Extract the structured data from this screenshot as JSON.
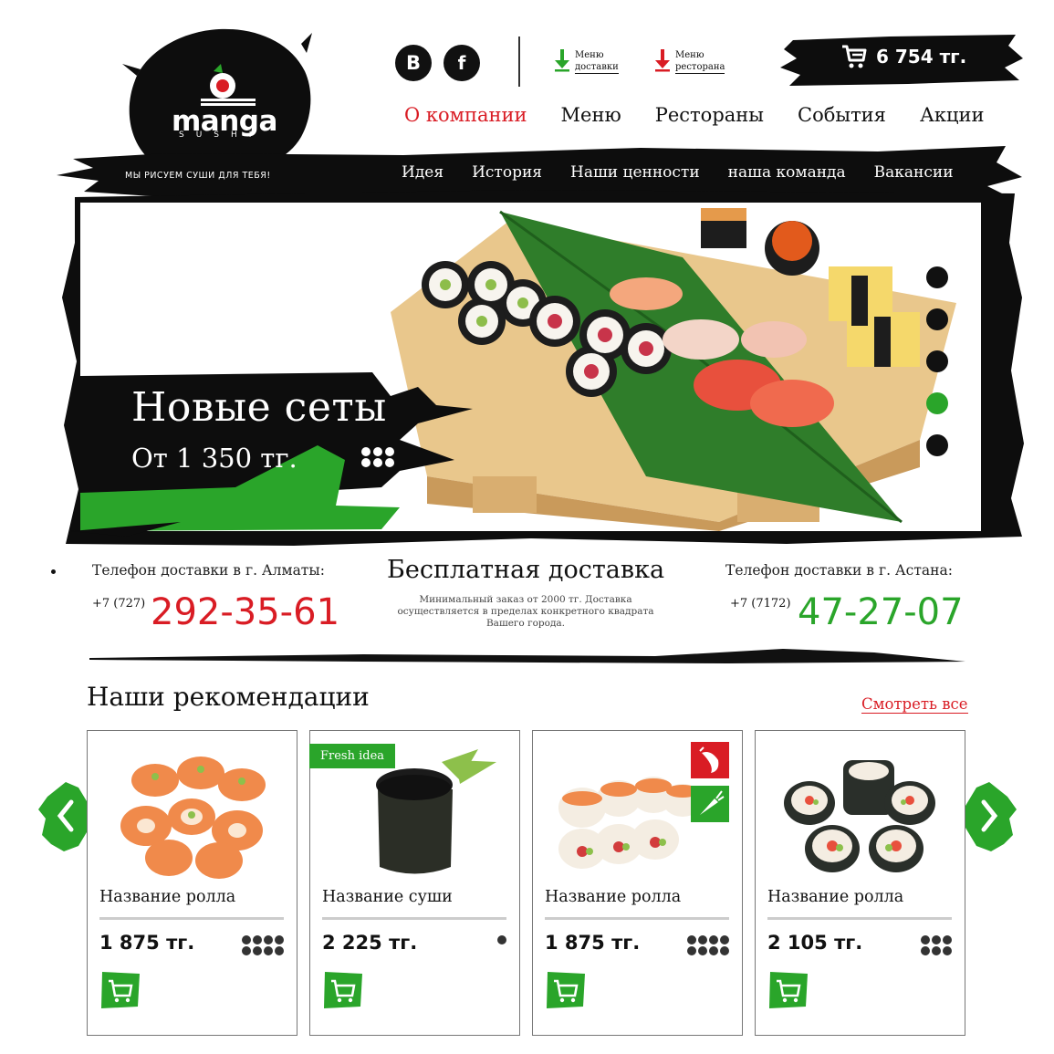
{
  "brand": {
    "name": "manga",
    "sub": "SUSHI",
    "tagline": "МЫ РИСУЕМ СУШИ ДЛЯ ТЕБЯ!"
  },
  "header": {
    "social": [
      {
        "label": "В",
        "icon": "vk-icon"
      },
      {
        "label": "f",
        "icon": "facebook-icon"
      }
    ],
    "menu_links": [
      {
        "line1": "Меню",
        "line2": "доставки",
        "color": "#2aa52a"
      },
      {
        "line1": "Меню",
        "line2": "ресторана",
        "color": "#d91c24"
      }
    ],
    "cart_total": "6 754 тг."
  },
  "main_nav": [
    {
      "label": "О компании",
      "active": true
    },
    {
      "label": "Меню"
    },
    {
      "label": "Рестораны"
    },
    {
      "label": "События"
    },
    {
      "label": "Акции"
    }
  ],
  "sub_nav": [
    "Идея",
    "История",
    "Наши ценности",
    "наша команда",
    "Вакансии"
  ],
  "hero": {
    "title": "Новые сеты",
    "price": "От 1 350 тг.",
    "slides": 5,
    "active_slide": 4
  },
  "delivery": {
    "almaty": {
      "label": "Телефон доставки в г. Алматы:",
      "code": "+7 (727)",
      "number": "292-35-61"
    },
    "free_title": "Бесплатная доставка",
    "free_text": "Минимальный заказ от 2000 тг. Доставка осуществляется в пределах конкретного квадрата Вашего города.",
    "astana": {
      "label": "Телефон доставки в г. Астана:",
      "code": "+7 (7172)",
      "number": "47-27-07"
    }
  },
  "recommendations": {
    "title": "Наши рекомендации",
    "see_all": "Смотреть все",
    "products": [
      {
        "name": "Название ролла",
        "price": "1 875 тг.",
        "badge": ""
      },
      {
        "name": "Название суши",
        "price": "2 225 тг.",
        "badge": "Fresh idea"
      },
      {
        "name": "Название ролла",
        "price": "1 875 тг.",
        "badge": ""
      },
      {
        "name": "Название ролла",
        "price": "2 105 тг.",
        "badge": ""
      }
    ]
  },
  "colors": {
    "accent_red": "#d91c24",
    "accent_green": "#2aa52a",
    "ink": "#111111"
  }
}
